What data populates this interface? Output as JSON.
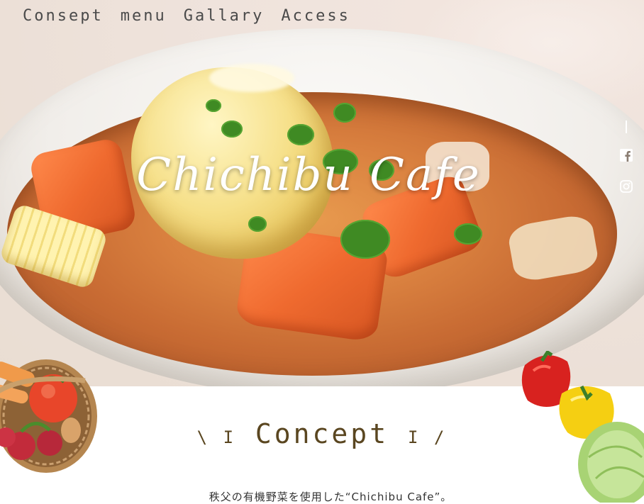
{
  "nav": {
    "items": [
      {
        "label": "Consept"
      },
      {
        "label": "menu"
      },
      {
        "label": "Gallary"
      },
      {
        "label": "Access"
      }
    ]
  },
  "hero": {
    "title": "Chichibu Cafe"
  },
  "social": {
    "icons": [
      "facebook-icon",
      "instagram-icon"
    ]
  },
  "concept": {
    "deco_left": "\\ I",
    "heading": "Concept",
    "deco_right": "I /",
    "text": "秩父の有機野菜を使用した“Chichibu Cafe”。"
  },
  "colors": {
    "heading": "#5a4620",
    "nav_text": "#4a4a4a",
    "hero_title": "#ffffff"
  }
}
